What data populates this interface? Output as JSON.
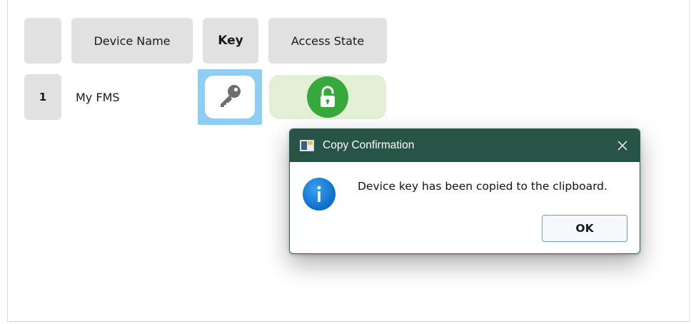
{
  "table": {
    "headers": {
      "index": "",
      "device_name": "Device Name",
      "key": "Key",
      "access_state": "Access State"
    },
    "rows": [
      {
        "index": "1",
        "device_name": "My FMS",
        "key_icon": "key-icon",
        "access_state_icon": "unlocked-padlock-icon"
      }
    ]
  },
  "dialog": {
    "title": "Copy Confirmation",
    "message": "Device key has been copied to the clipboard.",
    "ok_label": "OK",
    "icon": "info-icon",
    "close_icon": "close-icon"
  },
  "colors": {
    "dialog_titlebar": "#285447",
    "key_selected_bg": "#8ecdf6",
    "access_state_bg": "#e3f0d5",
    "unlocked_green": "#37a83c",
    "info_blue": "#0a69c7",
    "header_cell_bg": "#e1e1e1"
  }
}
